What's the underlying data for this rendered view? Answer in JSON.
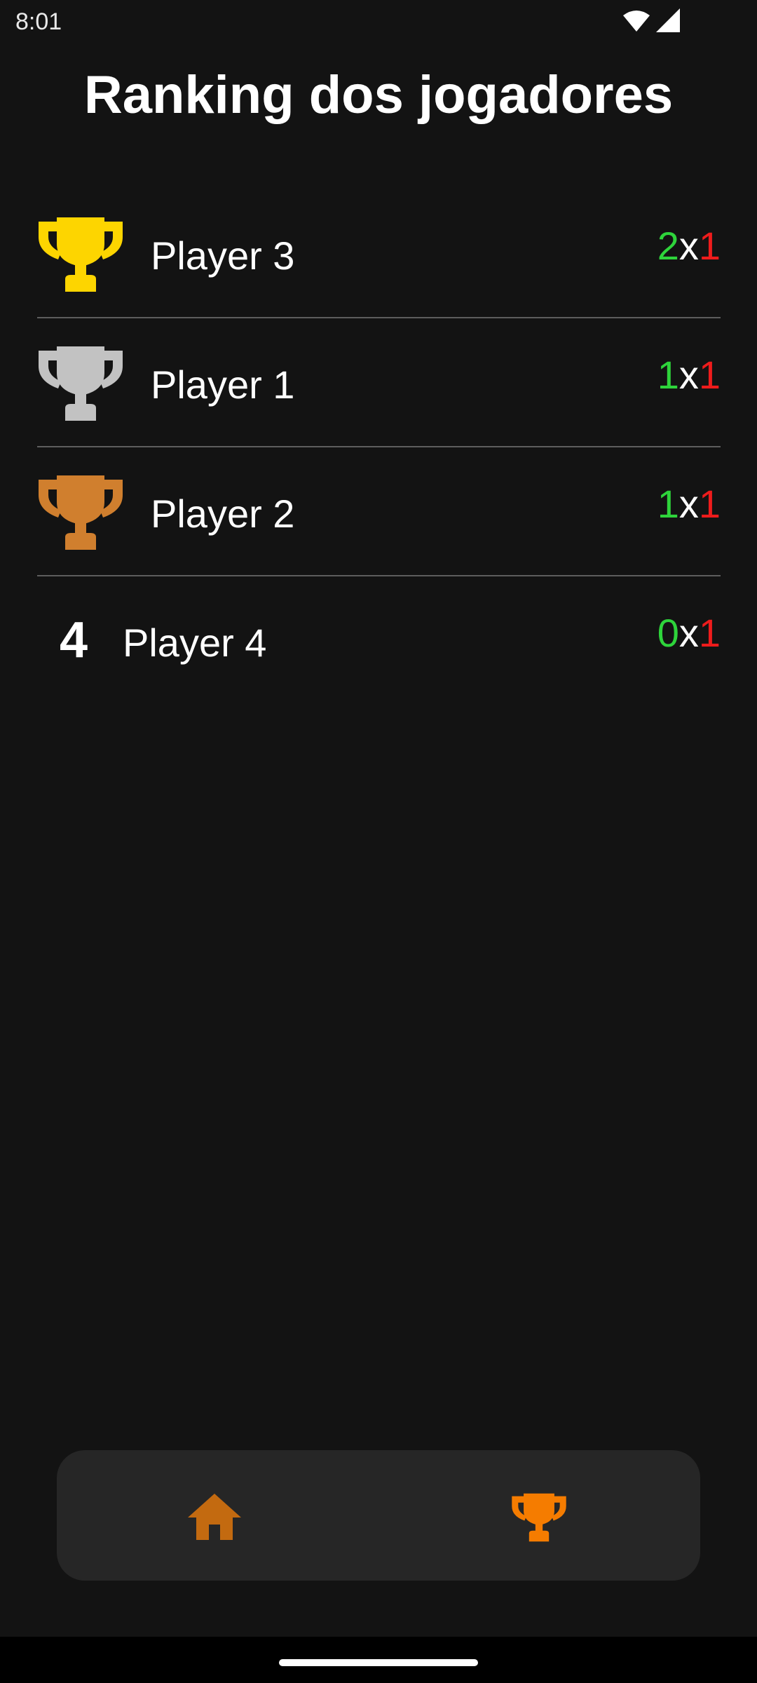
{
  "status_bar": {
    "time": "8:01",
    "icons": [
      "wifi-icon",
      "signal-icon"
    ]
  },
  "page": {
    "title": "Ranking dos jogadores"
  },
  "ranking": [
    {
      "position_icon": "gold-trophy-icon",
      "name": "Player 3",
      "wins": "2",
      "separator": "x",
      "losses": "1"
    },
    {
      "position_icon": "silver-trophy-icon",
      "name": "Player 1",
      "wins": "1",
      "separator": "x",
      "losses": "1"
    },
    {
      "position_icon": "bronze-trophy-icon",
      "name": "Player 2",
      "wins": "1",
      "separator": "x",
      "losses": "1"
    },
    {
      "rank": "4",
      "name": "Player 4",
      "wins": "0",
      "separator": "x",
      "losses": "1"
    }
  ],
  "bottom_nav": {
    "items": [
      {
        "icon": "home-icon",
        "color": "#c36a10"
      },
      {
        "icon": "trophy-icon",
        "color": "#f57c00",
        "active": true
      }
    ]
  },
  "colors": {
    "background": "#131313",
    "gold": "#fdd500",
    "silver": "#c2c2c2",
    "bronze": "#d07f2e",
    "wins": "#2ed43b",
    "losses": "#ee1c1c",
    "nav_background": "#262626"
  }
}
